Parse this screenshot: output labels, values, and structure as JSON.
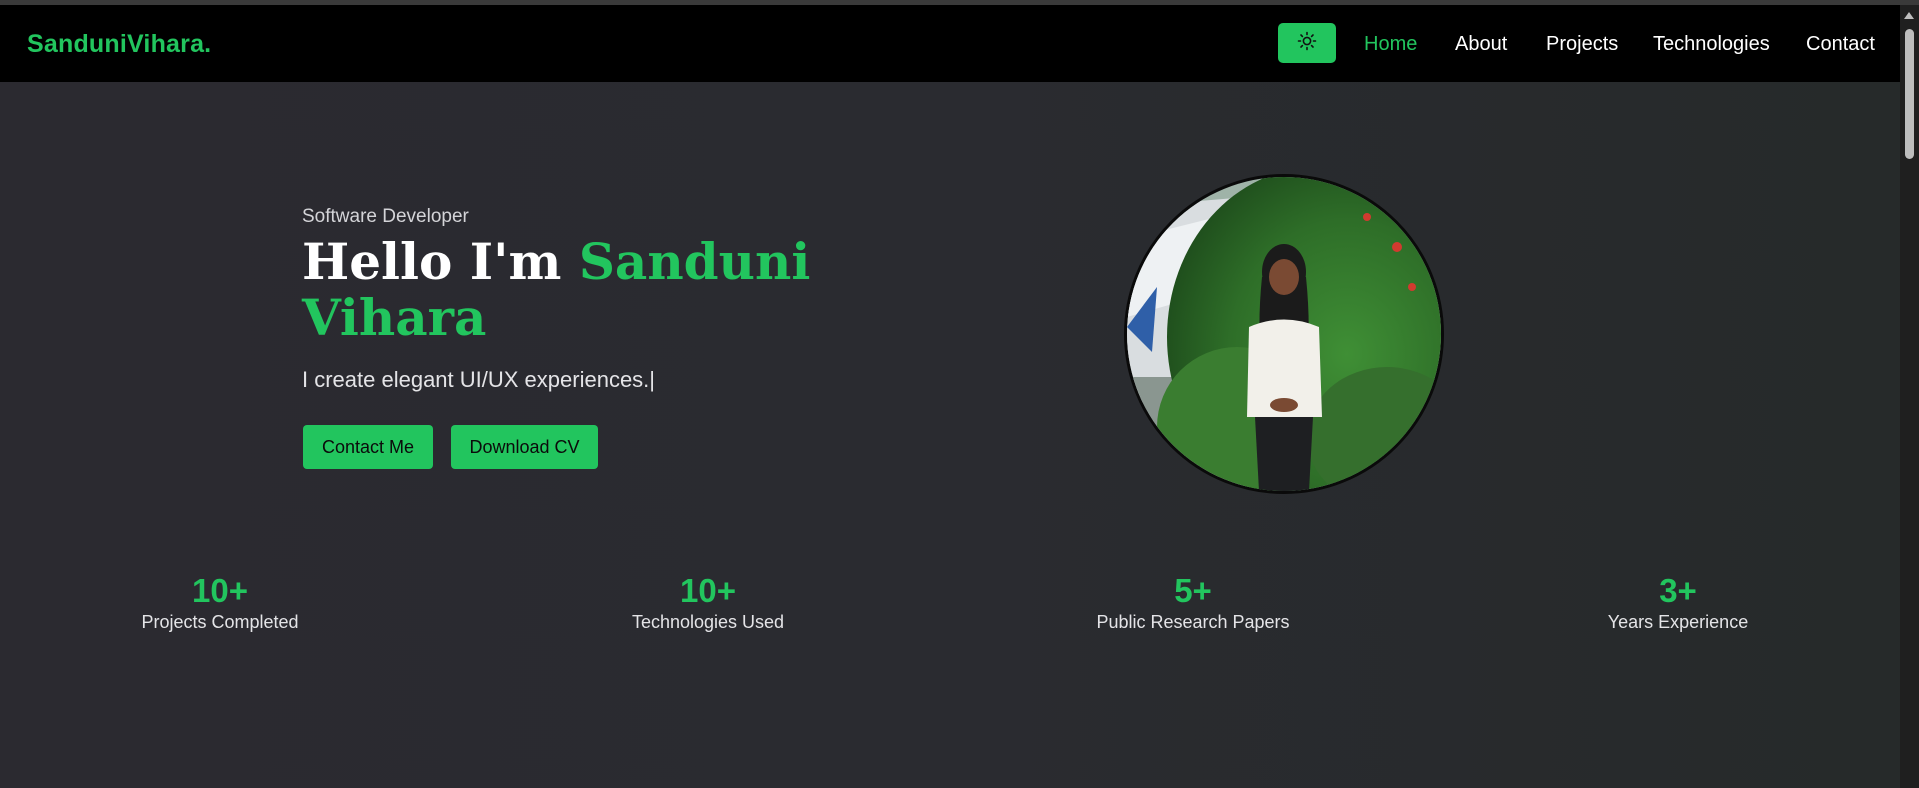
{
  "nav": {
    "brand": "SanduniVihara.",
    "theme_toggle_icon": "sun-icon",
    "items": [
      {
        "label": "Home",
        "active": true
      },
      {
        "label": "About",
        "active": false
      },
      {
        "label": "Projects",
        "active": false
      },
      {
        "label": "Technologies",
        "active": false
      },
      {
        "label": "Contact",
        "active": false
      }
    ]
  },
  "hero": {
    "role": "Software Developer",
    "greeting": "Hello I'm",
    "name": "Sanduni Vihara",
    "tagline": "I create elegant UI/UX experiences.|",
    "buttons": {
      "contact": "Contact Me",
      "download": "Download CV"
    }
  },
  "stats": [
    {
      "value": "10+",
      "label": "Projects Completed"
    },
    {
      "value": "10+",
      "label": "Technologies Used"
    },
    {
      "value": "5+",
      "label": "Public Research Papers"
    },
    {
      "value": "3+",
      "label": "Years Experience"
    }
  ],
  "colors": {
    "accent": "#22c55e",
    "nav_background": "#000000",
    "page_background": "#2a2a2f"
  }
}
